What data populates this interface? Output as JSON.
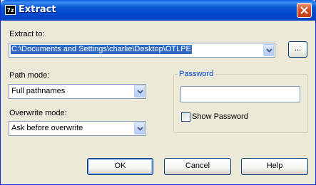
{
  "window": {
    "title": "Extract",
    "icon": "7z-app-icon"
  },
  "extract_to": {
    "label": "Extract to:",
    "value": "C:\\Documents and Settings\\charlie\\Desktop\\OTLPE",
    "browse_label": "..."
  },
  "path_mode": {
    "label": "Path mode:",
    "value": "Full pathnames"
  },
  "overwrite_mode": {
    "label": "Overwrite mode:",
    "value": "Ask before overwrite"
  },
  "password": {
    "group_label": "Password",
    "value": "",
    "show_label": "Show Password",
    "show_checked": false
  },
  "buttons": {
    "ok": "OK",
    "cancel": "Cancel",
    "help": "Help"
  },
  "colors": {
    "title_bar": "#0a57d6",
    "selection": "#316ac5",
    "group_label": "#0046d5",
    "background": "#ece9d8"
  }
}
